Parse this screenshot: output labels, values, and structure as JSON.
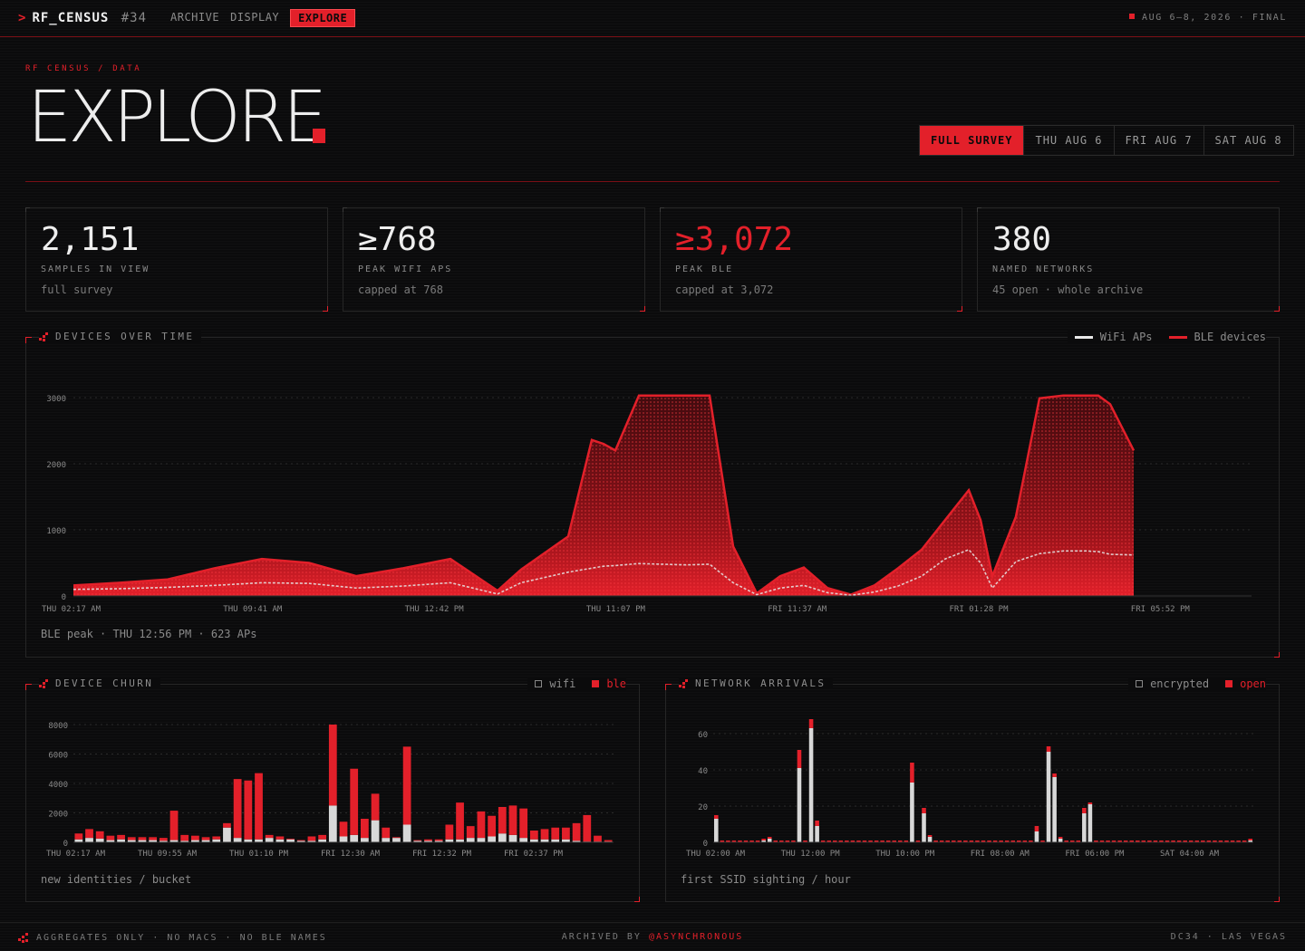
{
  "nav": {
    "brand": "RF_CENSUS",
    "brand_num": "#34",
    "items": [
      "ARCHIVE",
      "DISPLAY",
      "EXPLORE"
    ],
    "active": "EXPLORE",
    "date_range": "AUG 6–8, 2026 · FINAL"
  },
  "hero": {
    "breadcrumb": "RF CENSUS / DATA",
    "title": "EXPLORE",
    "tabs": [
      "FULL SURVEY",
      "THU AUG 6",
      "FRI AUG 7",
      "SAT AUG 8"
    ],
    "active_tab": "FULL SURVEY"
  },
  "stats": [
    {
      "value": "2,151",
      "label": "SAMPLES IN VIEW",
      "sub": "full survey"
    },
    {
      "value": "≥768",
      "label": "PEAK WIFI APS",
      "sub": "capped at 768"
    },
    {
      "value": "≥3,072",
      "label": "PEAK BLE",
      "sub": "capped at 3,072"
    },
    {
      "value": "380",
      "label": "NAMED NETWORKS",
      "sub": "45 open · whole archive"
    }
  ],
  "colors": {
    "accent": "#e3202a",
    "wifi": "#e8e8e8",
    "ble": "#e3202a"
  },
  "chart_data": [
    {
      "type": "area",
      "title": "DEVICES OVER TIME",
      "legend": [
        "WiFi APs",
        "BLE devices"
      ],
      "ylim": [
        0,
        3000
      ],
      "yticks": [
        0,
        1000,
        2000,
        3000
      ],
      "xticks": [
        "THU 02:17 AM",
        "THU 09:41 AM",
        "THU 12:42 PM",
        "THU 11:07 PM",
        "FRI 11:37 AM",
        "FRI 01:28 PM",
        "FRI 05:52 PM"
      ],
      "x": [
        0,
        0.04,
        0.08,
        0.12,
        0.16,
        0.2,
        0.24,
        0.28,
        0.32,
        0.36,
        0.38,
        0.42,
        0.44,
        0.45,
        0.46,
        0.48,
        0.5,
        0.52,
        0.54,
        0.56,
        0.58,
        0.6,
        0.62,
        0.64,
        0.66,
        0.68,
        0.7,
        0.72,
        0.74,
        0.76,
        0.77,
        0.78,
        0.8,
        0.82,
        0.84,
        0.86,
        0.87,
        0.88,
        0.9
      ],
      "series": [
        {
          "name": "BLE devices",
          "values": [
            160,
            200,
            250,
            420,
            560,
            500,
            300,
            420,
            560,
            80,
            400,
            900,
            2360,
            2300,
            2200,
            3030,
            3030,
            3030,
            3030,
            750,
            40,
            300,
            430,
            120,
            20,
            160,
            420,
            700,
            1150,
            1600,
            1150,
            300,
            1200,
            2990,
            3030,
            3030,
            3030,
            2900,
            2200
          ]
        },
        {
          "name": "WiFi APs",
          "values": [
            100,
            110,
            130,
            160,
            200,
            190,
            120,
            150,
            200,
            30,
            200,
            360,
            420,
            450,
            460,
            490,
            480,
            470,
            480,
            200,
            20,
            120,
            160,
            50,
            10,
            60,
            150,
            300,
            560,
            700,
            500,
            120,
            520,
            640,
            680,
            680,
            670,
            630,
            620
          ]
        }
      ],
      "note": "BLE peak · THU 12:56 PM · 623 APs"
    },
    {
      "type": "bar",
      "title": "DEVICE CHURN",
      "legend": [
        "wifi",
        "ble"
      ],
      "ylim": [
        0,
        8000
      ],
      "yticks": [
        0,
        2000,
        4000,
        6000,
        8000
      ],
      "xticks": [
        "THU 02:17 AM",
        "THU 09:55 AM",
        "THU 01:10 PM",
        "FRI 12:30 AM",
        "FRI 12:32 PM",
        "FRI 02:37 PM"
      ],
      "series": [
        {
          "name": "wifi",
          "values": [
            200,
            300,
            250,
            150,
            200,
            150,
            150,
            150,
            100,
            150,
            100,
            150,
            150,
            200,
            1000,
            300,
            200,
            200,
            300,
            200,
            200,
            100,
            100,
            200,
            2500,
            400,
            500,
            300,
            1500,
            300,
            300,
            1200,
            100,
            100,
            100,
            200,
            200,
            300,
            300,
            400,
            600,
            500,
            300,
            200,
            200,
            200,
            200,
            100,
            50,
            50,
            50
          ]
        },
        {
          "name": "ble",
          "values": [
            400,
            600,
            500,
            300,
            300,
            200,
            200,
            200,
            200,
            2000,
            400,
            300,
            200,
            200,
            300,
            4000,
            4000,
            4500,
            200,
            200,
            50,
            50,
            300,
            300,
            5500,
            1000,
            4500,
            1300,
            1800,
            700,
            50,
            5300,
            50,
            100,
            100,
            1000,
            2500,
            800,
            1800,
            1400,
            1800,
            2000,
            2000,
            600,
            700,
            800,
            800,
            1200,
            1800,
            400,
            100
          ]
        }
      ],
      "note": "new identities / bucket"
    },
    {
      "type": "bar",
      "title": "NETWORK ARRIVALS",
      "legend": [
        "encrypted",
        "open"
      ],
      "ylim": [
        0,
        65
      ],
      "yticks": [
        0,
        20,
        40,
        60
      ],
      "xticks": [
        "THU 02:00 AM",
        "THU 12:00 PM",
        "THU 10:00 PM",
        "FRI 08:00 AM",
        "FRI 06:00 PM",
        "SAT 04:00 AM"
      ],
      "series": [
        {
          "name": "encrypted",
          "values": [
            13,
            0,
            0,
            0,
            0,
            0,
            0,
            0,
            1,
            2,
            0,
            0,
            0,
            0,
            41,
            0,
            63,
            9,
            0,
            0,
            0,
            0,
            0,
            0,
            0,
            0,
            0,
            0,
            0,
            0,
            0,
            0,
            0,
            33,
            0,
            16,
            3,
            0,
            0,
            0,
            0,
            0,
            0,
            0,
            0,
            0,
            0,
            0,
            0,
            0,
            0,
            0,
            0,
            0,
            6,
            0,
            50,
            36,
            2,
            0,
            0,
            0,
            16,
            21,
            0,
            0,
            0,
            0,
            0,
            0,
            0,
            0,
            0,
            0,
            0,
            0,
            0,
            0,
            0,
            0,
            0,
            0,
            0,
            0,
            0,
            0,
            0,
            0,
            0,
            0,
            1
          ]
        },
        {
          "name": "open",
          "values": [
            2,
            1,
            1,
            1,
            1,
            1,
            1,
            1,
            1,
            1,
            1,
            1,
            1,
            1,
            10,
            1,
            5,
            3,
            1,
            1,
            1,
            1,
            1,
            1,
            1,
            1,
            1,
            1,
            1,
            1,
            1,
            1,
            1,
            11,
            1,
            3,
            1,
            1,
            1,
            1,
            1,
            1,
            1,
            1,
            1,
            1,
            1,
            1,
            1,
            1,
            1,
            1,
            1,
            1,
            3,
            1,
            3,
            2,
            1,
            1,
            1,
            1,
            3,
            1,
            1,
            1,
            1,
            1,
            1,
            1,
            1,
            1,
            1,
            1,
            1,
            1,
            1,
            1,
            1,
            1,
            1,
            1,
            1,
            1,
            1,
            1,
            1,
            1,
            1,
            1,
            1
          ]
        }
      ],
      "note": "first SSID sighting / hour"
    }
  ],
  "footer": {
    "left": "AGGREGATES ONLY · NO MACS · NO BLE NAMES",
    "center_prefix": "ARCHIVED BY",
    "center_handle": "@ASYNCHRONOUS",
    "right": "DC34 · LAS VEGAS"
  }
}
